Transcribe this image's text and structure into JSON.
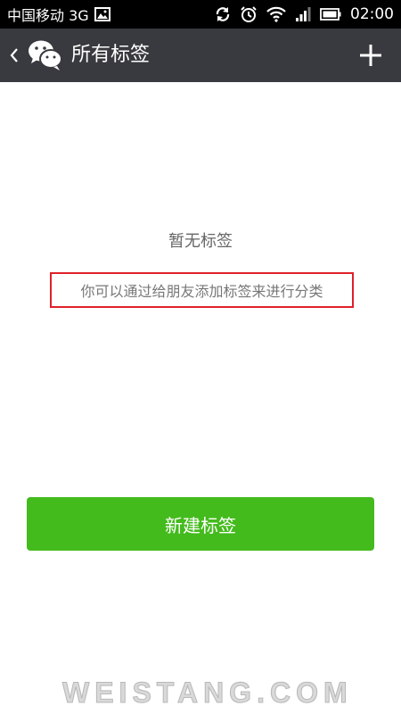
{
  "status_bar": {
    "carrier": "中国移动 3G",
    "time": "02:00",
    "icons": [
      "image-icon",
      "sync-icon",
      "alarm-icon",
      "wifi-icon",
      "signal-icon",
      "battery-icon"
    ]
  },
  "title_bar": {
    "title": "所有标签",
    "icons": [
      "back-arrow-icon",
      "wechat-logo-icon",
      "plus-icon"
    ]
  },
  "empty_state": {
    "title": "暂无标签",
    "description": "你可以通过给朋友添加标签来进行分类",
    "highlight_color": "#e0202a"
  },
  "actions": {
    "new_tag_label": "新建标签",
    "button_color": "#44bb1d"
  },
  "watermark": {
    "text": "WEISTANG.COM"
  }
}
